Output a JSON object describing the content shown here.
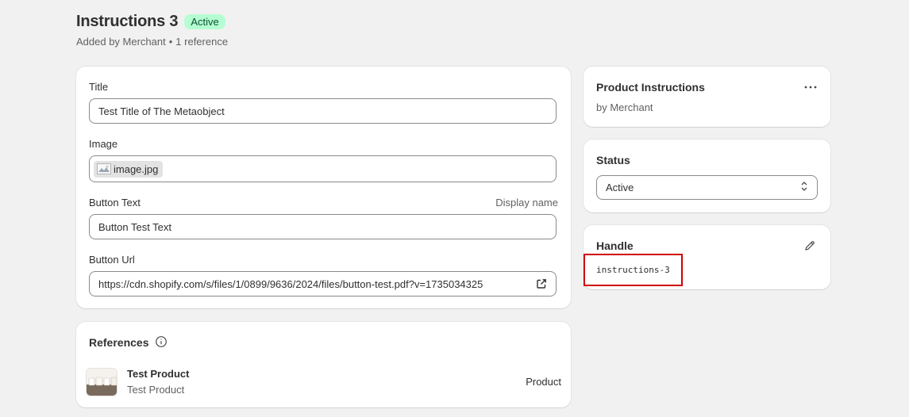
{
  "header": {
    "title": "Instructions 3",
    "status_badge": "Active",
    "added_by": "Added by Merchant",
    "separator": "•",
    "references_count": "1 reference"
  },
  "fields": {
    "title": {
      "label": "Title",
      "value": "Test Title of The Metaobject"
    },
    "image": {
      "label": "Image",
      "file_name": "image.jpg"
    },
    "button_text": {
      "label": "Button Text",
      "hint": "Display name",
      "value": "Button Test Text"
    },
    "button_url": {
      "label": "Button Url",
      "value": "https://cdn.shopify.com/s/files/1/0899/9636/2024/files/button-test.pdf?v=1735034325"
    }
  },
  "references": {
    "heading": "References",
    "items": [
      {
        "name": "Test Product",
        "subtitle": "Test Product",
        "type": "Product"
      }
    ]
  },
  "sidebar": {
    "definition": {
      "name": "Product Instructions",
      "owner": "by Merchant"
    },
    "status": {
      "heading": "Status",
      "selected": "Active"
    },
    "handle": {
      "heading": "Handle",
      "value": "instructions-3"
    }
  },
  "colors": {
    "background": "#f1f1f1",
    "badge_bg": "#b4fed2",
    "badge_text": "#0c5132",
    "highlight": "#d10000"
  },
  "icons": [
    "image-icon",
    "external-link-icon",
    "info-icon",
    "more-horizontal-icon",
    "chevron-up-down-icon",
    "pencil-icon",
    "product-thumbnail"
  ]
}
